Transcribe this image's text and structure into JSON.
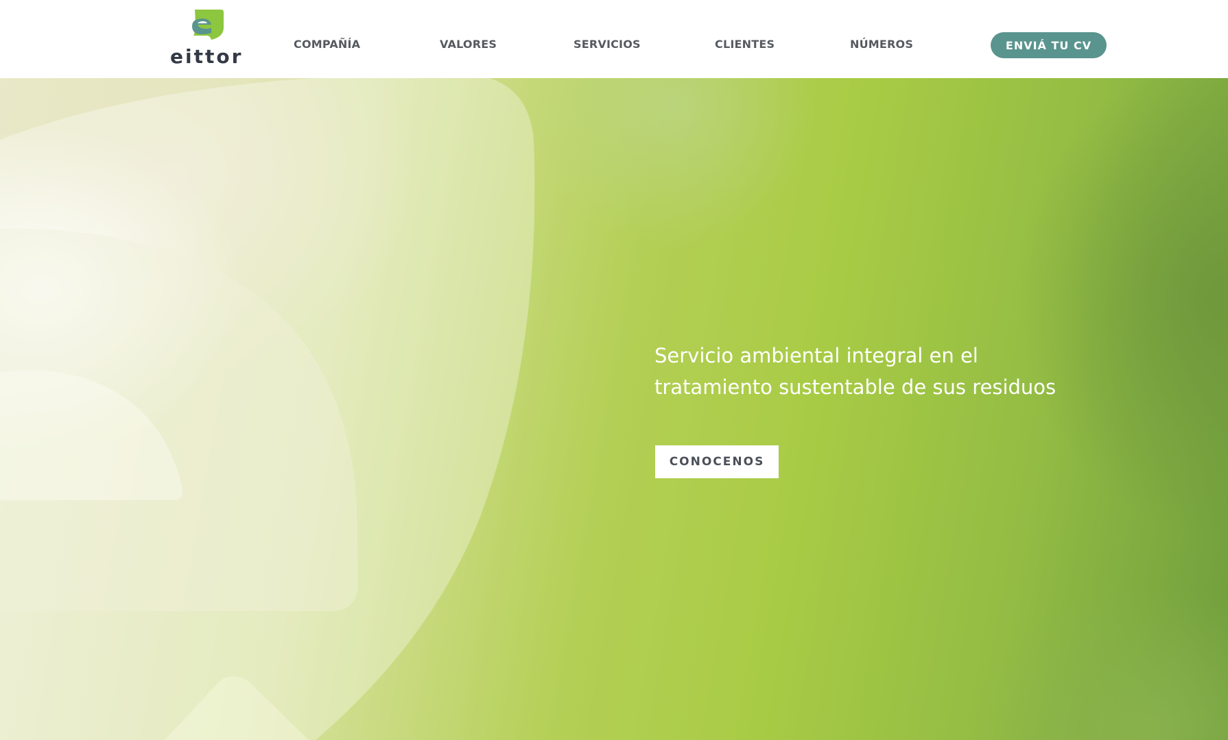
{
  "brand": {
    "name": "eittor",
    "logo_icon": "eittor-logo-icon",
    "colors": {
      "accent": "#5a948e",
      "logo_green": "#8dc63f",
      "logo_teal": "#5a948e",
      "nav_text": "#555a60"
    }
  },
  "nav": {
    "items": [
      {
        "label": "COMPAÑÍA"
      },
      {
        "label": "VALORES"
      },
      {
        "label": "SERVICIOS"
      },
      {
        "label": "CLIENTES"
      },
      {
        "label": "NÚMEROS"
      }
    ],
    "cta_label": "ENVIÁ TU CV"
  },
  "hero": {
    "title": "Servicio ambiental integral en el tratamiento sustentable de sus residuos",
    "button_label": "CONOCENOS",
    "background_graphic": "large-e-logo-watermark"
  }
}
